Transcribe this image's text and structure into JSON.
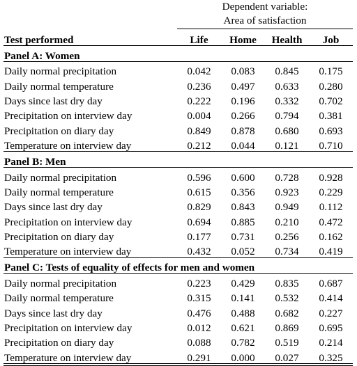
{
  "header": {
    "dependent_variable_line1": "Dependent variable:",
    "dependent_variable_line2": "Area of satisfaction",
    "row_label_header": "Test performed",
    "columns": [
      "Life",
      "Home",
      "Health",
      "Job"
    ]
  },
  "panels": [
    {
      "title": "Panel A: Women",
      "rows": [
        {
          "label": "Daily normal precipitation",
          "values": [
            "0.042",
            "0.083",
            "0.845",
            "0.175"
          ]
        },
        {
          "label": "Daily normal temperature",
          "values": [
            "0.236",
            "0.497",
            "0.633",
            "0.280"
          ]
        },
        {
          "label": "Days since last dry day",
          "values": [
            "0.222",
            "0.196",
            "0.332",
            "0.702"
          ]
        },
        {
          "label": "Precipitation on interview day",
          "values": [
            "0.004",
            "0.266",
            "0.794",
            "0.381"
          ]
        },
        {
          "label": "Precipitation on diary day",
          "values": [
            "0.849",
            "0.878",
            "0.680",
            "0.693"
          ]
        },
        {
          "label": "Temperature on interview day",
          "values": [
            "0.212",
            "0.044",
            "0.121",
            "0.710"
          ]
        }
      ]
    },
    {
      "title": "Panel B: Men",
      "rows": [
        {
          "label": "Daily normal precipitation",
          "values": [
            "0.596",
            "0.600",
            "0.728",
            "0.928"
          ]
        },
        {
          "label": "Daily normal temperature",
          "values": [
            "0.615",
            "0.356",
            "0.923",
            "0.229"
          ]
        },
        {
          "label": "Days since last dry day",
          "values": [
            "0.829",
            "0.843",
            "0.949",
            "0.112"
          ]
        },
        {
          "label": "Precipitation on interview day",
          "values": [
            "0.694",
            "0.885",
            "0.210",
            "0.472"
          ]
        },
        {
          "label": "Precipitation on diary day",
          "values": [
            "0.177",
            "0.731",
            "0.256",
            "0.162"
          ]
        },
        {
          "label": "Temperature on interview day",
          "values": [
            "0.432",
            "0.052",
            "0.734",
            "0.419"
          ]
        }
      ]
    },
    {
      "title": "Panel C: Tests of equality of effects for men and women",
      "rows": [
        {
          "label": "Daily normal precipitation",
          "values": [
            "0.223",
            "0.429",
            "0.835",
            "0.687"
          ]
        },
        {
          "label": "Daily normal temperature",
          "values": [
            "0.315",
            "0.141",
            "0.532",
            "0.414"
          ]
        },
        {
          "label": "Days since last dry day",
          "values": [
            "0.476",
            "0.488",
            "0.682",
            "0.227"
          ]
        },
        {
          "label": "Precipitation on interview day",
          "values": [
            "0.012",
            "0.621",
            "0.869",
            "0.695"
          ]
        },
        {
          "label": "Precipitation on diary day",
          "values": [
            "0.088",
            "0.782",
            "0.519",
            "0.214"
          ]
        },
        {
          "label": "Temperature on interview day",
          "values": [
            "0.291",
            "0.000",
            "0.027",
            "0.325"
          ]
        }
      ]
    }
  ]
}
